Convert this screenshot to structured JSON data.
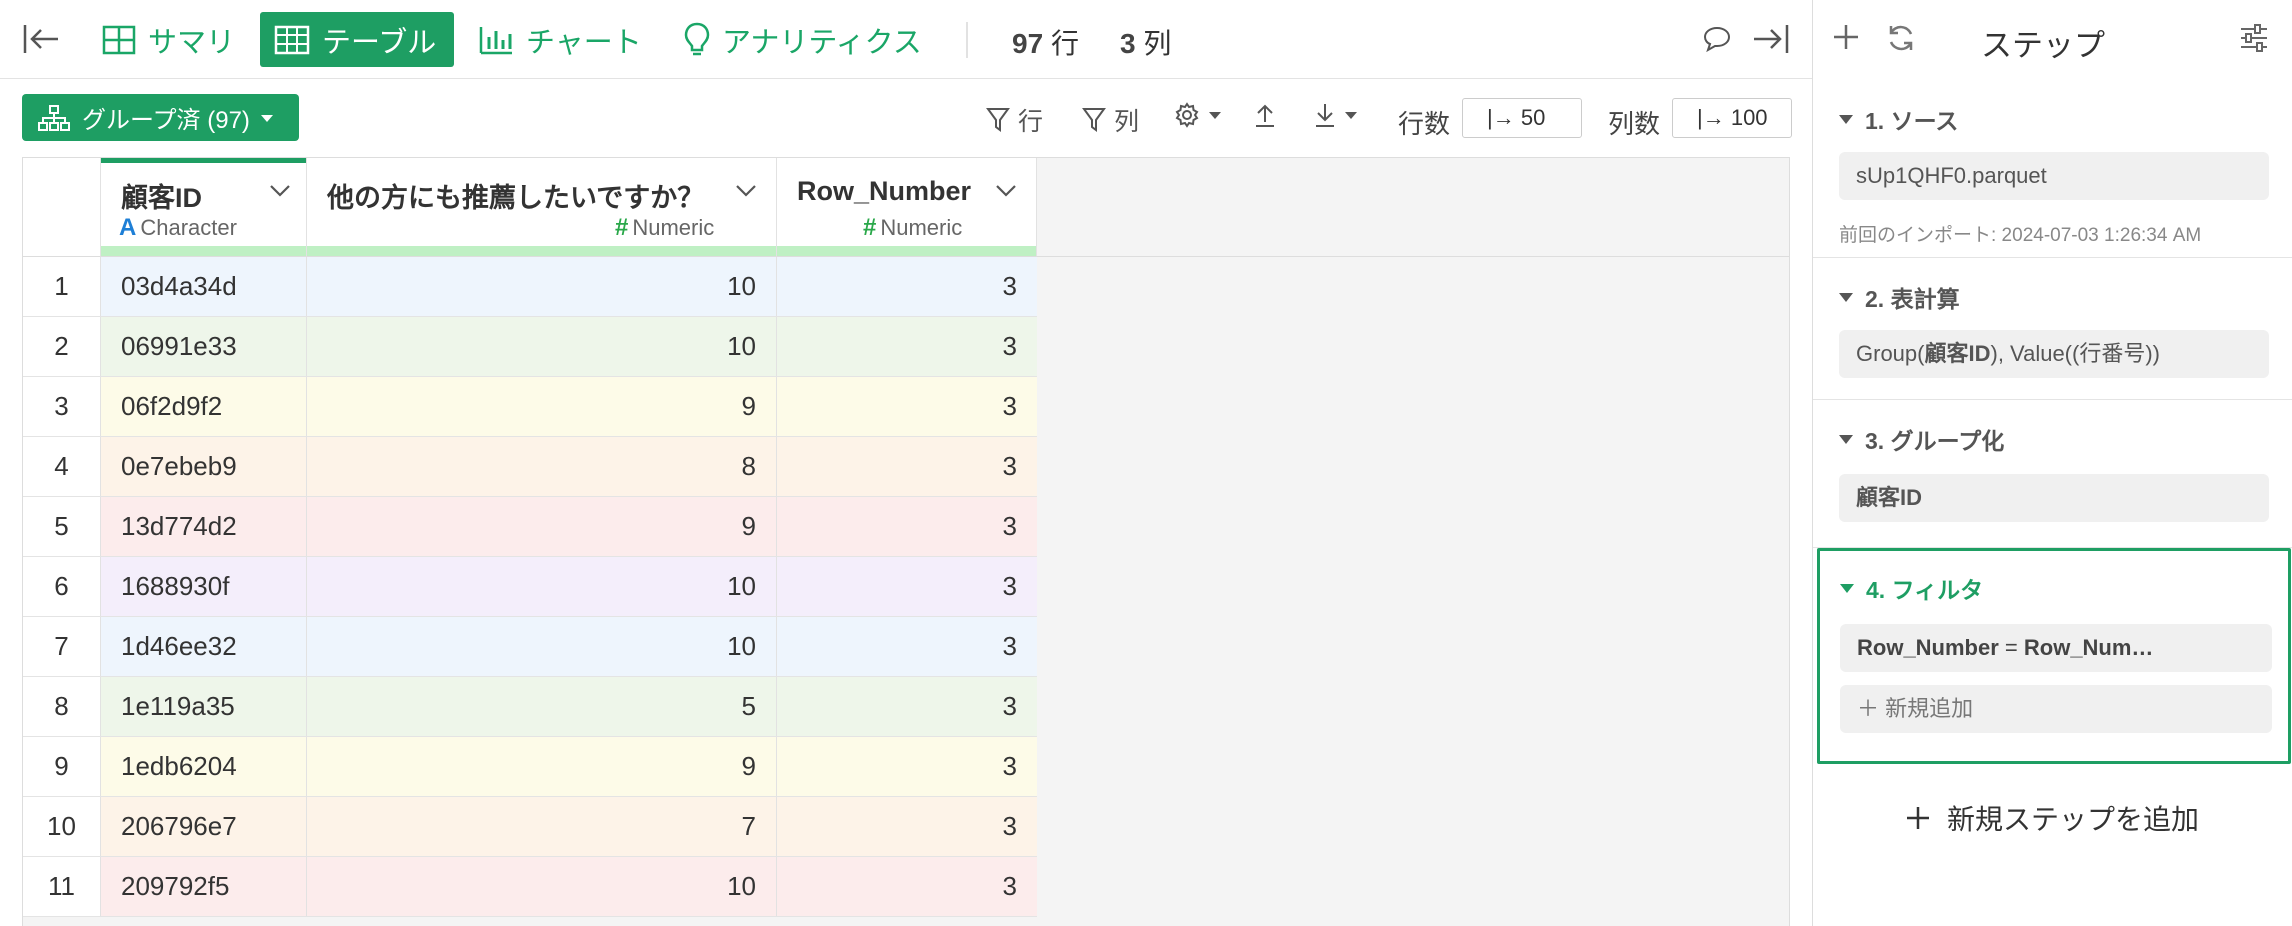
{
  "nav": {
    "tabs": [
      {
        "label": "サマリ",
        "icon": "summary-grid-icon"
      },
      {
        "label": "テーブル",
        "icon": "table-icon",
        "active": true
      },
      {
        "label": "チャート",
        "icon": "bar-chart-icon"
      },
      {
        "label": "アナリティクス",
        "icon": "lightbulb-icon"
      }
    ],
    "rows_count": "97",
    "rows_unit": "行",
    "cols_count": "3",
    "cols_unit": "列"
  },
  "toolbar": {
    "group_label": "グループ済 (97)",
    "filter_rows_label": "行",
    "filter_cols_label": "列",
    "rows_label": "行数",
    "rows_value": "|→ 50",
    "cols_label": "列数",
    "cols_value": "|→ 100"
  },
  "table": {
    "columns": [
      {
        "name": "顧客ID",
        "type": "Character",
        "type_icon": "A"
      },
      {
        "name": "他の方にも推薦したいですか？",
        "type": "Numeric",
        "type_icon": "#"
      },
      {
        "name": "Row_Number",
        "type": "Numeric",
        "type_icon": "#"
      }
    ],
    "rows": [
      {
        "idx": "1",
        "cust": "03d4a34d",
        "rec": "10",
        "rowno": "3"
      },
      {
        "idx": "2",
        "cust": "06991e33",
        "rec": "10",
        "rowno": "3"
      },
      {
        "idx": "3",
        "cust": "06f2d9f2",
        "rec": "9",
        "rowno": "3"
      },
      {
        "idx": "4",
        "cust": "0e7ebeb9",
        "rec": "8",
        "rowno": "3"
      },
      {
        "idx": "5",
        "cust": "13d774d2",
        "rec": "9",
        "rowno": "3"
      },
      {
        "idx": "6",
        "cust": "1688930f",
        "rec": "10",
        "rowno": "3"
      },
      {
        "idx": "7",
        "cust": "1d46ee32",
        "rec": "10",
        "rowno": "3"
      },
      {
        "idx": "8",
        "cust": "1e119a35",
        "rec": "5",
        "rowno": "3"
      },
      {
        "idx": "9",
        "cust": "1edb6204",
        "rec": "9",
        "rowno": "3"
      },
      {
        "idx": "10",
        "cust": "206796e7",
        "rec": "7",
        "rowno": "3"
      },
      {
        "idx": "11",
        "cust": "209792f5",
        "rec": "10",
        "rowno": "3"
      }
    ],
    "row_colors": [
      "#eef5fd",
      "#eef6ea",
      "#fdfbe8",
      "#fdf3e8",
      "#fcecec",
      "#f4eefb"
    ]
  },
  "panel": {
    "title": "ステップ",
    "steps": [
      {
        "title": "1. ソース",
        "chip": "sUp1QHF0.parquet",
        "meta": "前回のインポート: 2024-07-03 1:26:34 AM"
      },
      {
        "title": "2. 表計算",
        "chip_pre": "Group(",
        "chip_bold": "顧客ID",
        "chip_post": "), Value((行番号))"
      },
      {
        "title": "3. グループ化",
        "chip_bold": "顧客ID"
      },
      {
        "title": "4. フィルタ",
        "chip_bold1": "Row_Number",
        "chip_op": " = ",
        "chip_bold2": "Row_Num…",
        "add_label": "新規追加"
      }
    ],
    "add_step_label": "新規ステップを追加"
  }
}
